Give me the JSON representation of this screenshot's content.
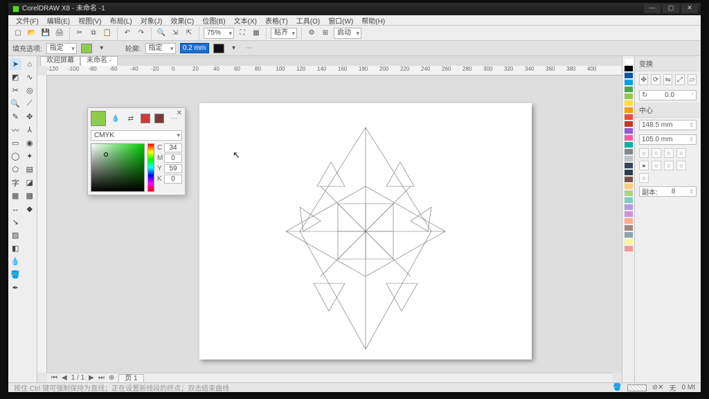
{
  "title": "CorelDRAW X8 - 未命名 -1",
  "menus": [
    "文件(F)",
    "编辑(E)",
    "视图(V)",
    "布局(L)",
    "对象(J)",
    "效果(C)",
    "位图(B)",
    "文本(X)",
    "表格(T)",
    "工具(O)",
    "窗口(W)",
    "帮助(H)"
  ],
  "toolbar": {
    "zoom": "75%",
    "snap_label": "贴齐",
    "launch_label": "启动"
  },
  "propbar": {
    "fill_label": "填充选项:",
    "fill_mode": "指定",
    "swatch_color": "#8fcc4c",
    "outline_label": "轮廓:",
    "outline_mode": "指定",
    "outline_width": "0.2 mm",
    "outline_color": "#111111"
  },
  "tabs": {
    "welcome": "欢迎屏幕",
    "doc": "未命名 -"
  },
  "ruler_ticks": [
    "-120",
    "-100",
    "-80",
    "-60",
    "-40",
    "-20",
    "0",
    "20",
    "40",
    "60",
    "80",
    "100",
    "120",
    "140",
    "160",
    "180",
    "200",
    "220",
    "240",
    "260",
    "280",
    "300",
    "320",
    "340",
    "360",
    "380",
    "400"
  ],
  "color_flyout": {
    "big_swatch": "#8fcc4c",
    "recents": [
      "#cc3a3a",
      "#7a3a3a",
      "#444444"
    ],
    "model": "CMYK",
    "c": "34",
    "m": "0",
    "y": "59",
    "k": "0"
  },
  "rightpanel": {
    "title": "变换",
    "rotation": "0.0",
    "center_label": "中心",
    "cx": "148.5 mm",
    "cy": "105.0 mm",
    "copies_label": "副本:",
    "copies": "8"
  },
  "status": {
    "hint_left": "按住 Ctrl 键可强制保持为直线；正在设置新线段的终点；双击结束曲线",
    "none": "无",
    "fill_label": "0 Mt"
  },
  "page_tabs": {
    "p1": "页 1"
  },
  "palette_colors": [
    "#ffffff",
    "#000000",
    "#1057a6",
    "#00a3e0",
    "#4aa84a",
    "#8fcc4c",
    "#ffe03a",
    "#f59b1e",
    "#e84c3d",
    "#c0392b",
    "#8e5bd0",
    "#ee5fa7",
    "#00b3a0",
    "#7f8c8d",
    "#bdc3c7",
    "#34495e",
    "#2c3e50",
    "#795548",
    "#ffcc80",
    "#aed581",
    "#80cbc4",
    "#b39ddb",
    "#ce93d8",
    "#ffab91",
    "#a1887f",
    "#90a4ae",
    "#fff59d",
    "#ef9a9a"
  ]
}
